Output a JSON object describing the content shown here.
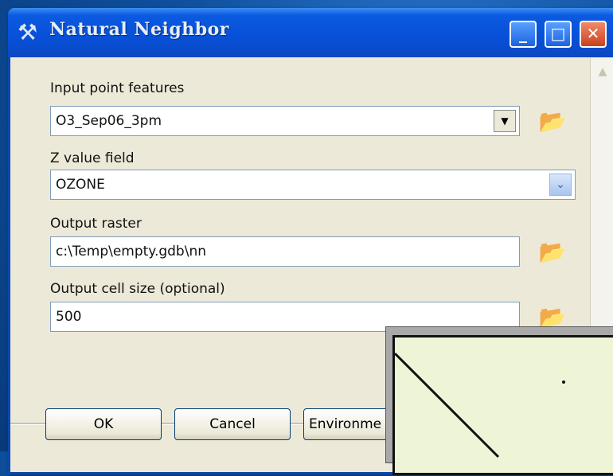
{
  "window": {
    "title": "Natural Neighbor"
  },
  "fields": {
    "input_point_features": {
      "label": "Input point features",
      "value": "O3_Sep06_3pm"
    },
    "z_value_field": {
      "label": "Z value field",
      "value": "OZONE"
    },
    "output_raster": {
      "label": "Output raster",
      "value": "c:\\Temp\\empty.gdb\\nn"
    },
    "output_cell_size": {
      "label": "Output cell size (optional)",
      "value": "500"
    }
  },
  "buttons": {
    "ok": "OK",
    "cancel": "Cancel",
    "environments": "Environme"
  },
  "icons": {
    "title": "hammer-icon",
    "folder": "open-folder-icon",
    "dropdown": "chevron-down-icon"
  },
  "colors": {
    "titlebar": "#0850d8",
    "dialog_bg": "#ece9d8",
    "close_button": "#c9421f",
    "inset_map_bg": "#eef5d6"
  }
}
